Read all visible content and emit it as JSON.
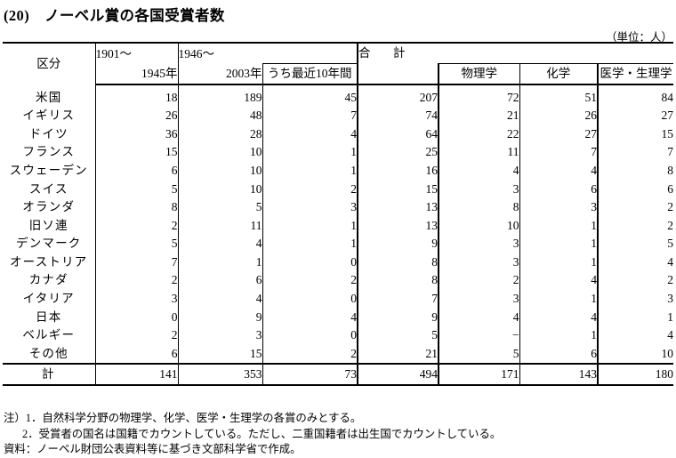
{
  "title": "(20)　ノーベル賞の各国受賞者数",
  "unit_note": "（単位：人）",
  "table": {
    "headers": {
      "kubun": "区分",
      "period1_top": "1901〜",
      "period1_bottom": "1945年",
      "period2_top": "1946〜",
      "period2_bottom": "2003年",
      "recent10": "うち最近10年間",
      "total": "合　計",
      "physics": "物理学",
      "chemistry": "化学",
      "medicine": "医学・生理学"
    },
    "rows": [
      {
        "country": "米国",
        "p1": "18",
        "p2": "189",
        "recent": "45",
        "total": "207",
        "phy": "72",
        "chem": "51",
        "med": "84"
      },
      {
        "country": "イギリス",
        "p1": "26",
        "p2": "48",
        "recent": "7",
        "total": "74",
        "phy": "21",
        "chem": "26",
        "med": "27"
      },
      {
        "country": "ドイツ",
        "p1": "36",
        "p2": "28",
        "recent": "4",
        "total": "64",
        "phy": "22",
        "chem": "27",
        "med": "15"
      },
      {
        "country": "フランス",
        "p1": "15",
        "p2": "10",
        "recent": "1",
        "total": "25",
        "phy": "11",
        "chem": "7",
        "med": "7"
      },
      {
        "country": "スウェーデン",
        "p1": "6",
        "p2": "10",
        "recent": "1",
        "total": "16",
        "phy": "4",
        "chem": "4",
        "med": "8"
      },
      {
        "country": "スイス",
        "p1": "5",
        "p2": "10",
        "recent": "2",
        "total": "15",
        "phy": "3",
        "chem": "6",
        "med": "6"
      },
      {
        "country": "オランダ",
        "p1": "8",
        "p2": "5",
        "recent": "3",
        "total": "13",
        "phy": "8",
        "chem": "3",
        "med": "2"
      },
      {
        "country": "旧ソ連",
        "p1": "2",
        "p2": "11",
        "recent": "1",
        "total": "13",
        "phy": "10",
        "chem": "1",
        "med": "2"
      },
      {
        "country": "デンマーク",
        "p1": "5",
        "p2": "4",
        "recent": "1",
        "total": "9",
        "phy": "3",
        "chem": "1",
        "med": "5"
      },
      {
        "country": "オーストリア",
        "p1": "7",
        "p2": "1",
        "recent": "0",
        "total": "8",
        "phy": "3",
        "chem": "1",
        "med": "4"
      },
      {
        "country": "カナダ",
        "p1": "2",
        "p2": "6",
        "recent": "2",
        "total": "8",
        "phy": "2",
        "chem": "4",
        "med": "2"
      },
      {
        "country": "イタリア",
        "p1": "3",
        "p2": "4",
        "recent": "0",
        "total": "7",
        "phy": "3",
        "chem": "1",
        "med": "3"
      },
      {
        "country": "日本",
        "p1": "0",
        "p2": "9",
        "recent": "4",
        "total": "9",
        "phy": "4",
        "chem": "4",
        "med": "1"
      },
      {
        "country": "ベルギー",
        "p1": "2",
        "p2": "3",
        "recent": "0",
        "total": "5",
        "phy": "−",
        "chem": "1",
        "med": "4"
      },
      {
        "country": "その他",
        "p1": "6",
        "p2": "15",
        "recent": "2",
        "total": "21",
        "phy": "5",
        "chem": "6",
        "med": "10"
      }
    ],
    "total_row": {
      "country": "計",
      "p1": "141",
      "p2": "353",
      "recent": "73",
      "total": "494",
      "phy": "171",
      "chem": "143",
      "med": "180"
    }
  },
  "notes": {
    "note1": "注）1．自然科学分野の物理学、化学、医学・生理学の各賞のみとする。",
    "note2": "2．受賞者の国名は国籍でカウントしている。ただし、二重国籍者は出生国でカウントしている。",
    "source": "資料：ノーベル財団公表資料等に基づき文部科学省で作成。"
  }
}
